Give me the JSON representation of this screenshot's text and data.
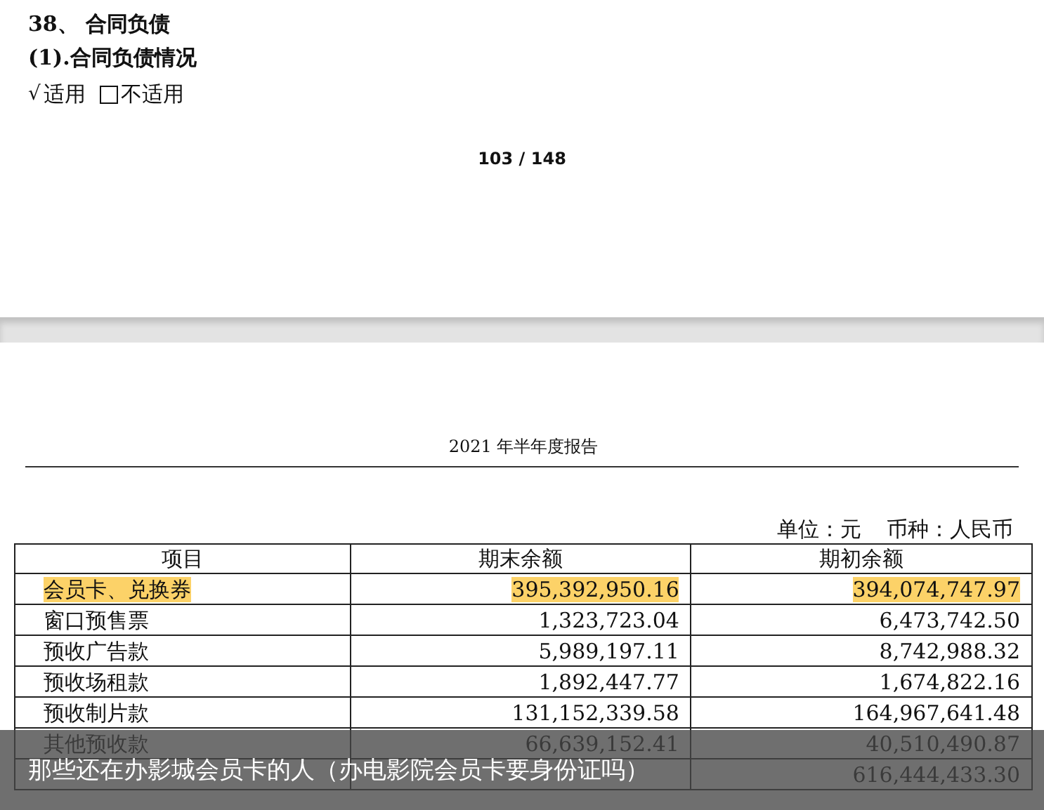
{
  "page_top": {
    "heading": "38、 合同负债",
    "subheading": "(1).合同负债情况",
    "tick": "√",
    "options": [
      {
        "label": "适用",
        "checked": true
      },
      {
        "label": "不适用",
        "checked": false
      }
    ],
    "page_number": "103 / 148"
  },
  "page_bottom": {
    "header": "2021 年半年度报告",
    "unit": "单位：元",
    "currency": "币种：人民币",
    "table": {
      "columns": [
        "项目",
        "期末余额",
        "期初余额"
      ],
      "rows": [
        {
          "cells": [
            "会员卡、兑换券",
            "395,392,950.16",
            "394,074,747.97"
          ],
          "highlighted": true
        },
        {
          "cells": [
            "窗口预售票",
            "1,323,723.04",
            "6,473,742.50"
          ],
          "highlighted": false
        },
        {
          "cells": [
            "预收广告款",
            "5,989,197.11",
            "8,742,988.32"
          ],
          "highlighted": false
        },
        {
          "cells": [
            "预收场租款",
            "1,892,447.77",
            "1,674,822.16"
          ],
          "highlighted": false
        },
        {
          "cells": [
            "预收制片款",
            "131,152,339.58",
            "164,967,641.48"
          ],
          "highlighted": false
        },
        {
          "cells": [
            "其他预收款",
            "66,639,152.41",
            "40,510,490.87"
          ],
          "highlighted": false
        },
        {
          "cells": [
            null,
            null,
            "616,444,433.30"
          ],
          "highlighted": false
        }
      ]
    }
  },
  "caption": "那些还在办影城会员卡的人（办电影院会员卡要身份证吗）"
}
